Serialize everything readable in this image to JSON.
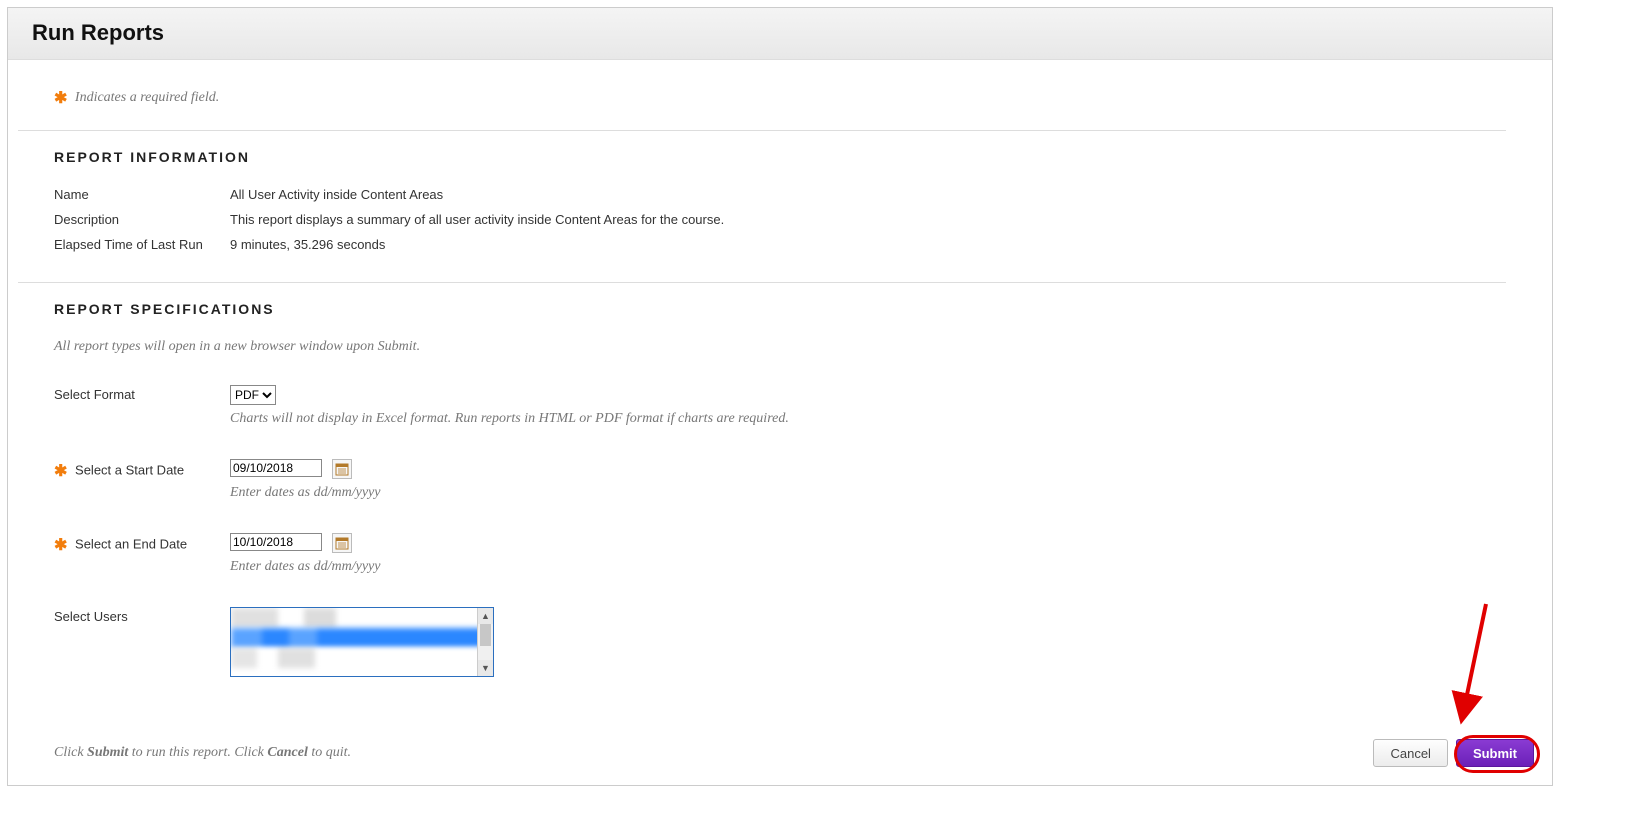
{
  "header": {
    "title": "Run Reports"
  },
  "required_note": "Indicates a required field.",
  "sections": {
    "info": {
      "title": "REPORT INFORMATION",
      "rows": {
        "name_label": "Name",
        "name_value": "All User Activity inside Content Areas",
        "desc_label": "Description",
        "desc_value": "This report displays a summary of all user activity inside Content Areas for the course.",
        "elapsed_label": "Elapsed Time of Last Run",
        "elapsed_value": "9 minutes, 35.296 seconds"
      }
    },
    "spec": {
      "title": "REPORT SPECIFICATIONS",
      "note": "All report types will open in a new browser window upon Submit.",
      "format": {
        "label": "Select Format",
        "value": "PDF",
        "hint": "Charts will not display in Excel format. Run reports in HTML or PDF format if charts are required."
      },
      "start_date": {
        "label": "Select a Start Date",
        "value": "09/10/2018",
        "hint": "Enter dates as dd/mm/yyyy"
      },
      "end_date": {
        "label": "Select an End Date",
        "value": "10/10/2018",
        "hint": "Enter dates as dd/mm/yyyy"
      },
      "users": {
        "label": "Select Users"
      }
    }
  },
  "footer": {
    "note_pre": "Click ",
    "note_submit": "Submit",
    "note_mid": " to run this report. Click ",
    "note_cancel": "Cancel",
    "note_post": " to quit.",
    "cancel_label": "Cancel",
    "submit_label": "Submit"
  }
}
